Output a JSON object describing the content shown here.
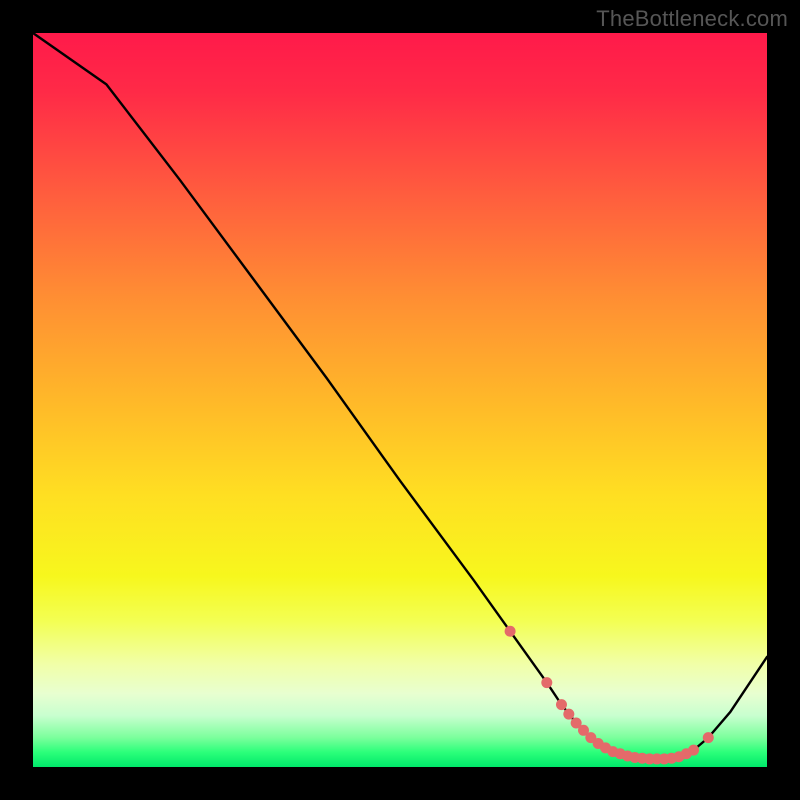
{
  "watermark": "TheBottleneck.com",
  "chart_data": {
    "type": "line",
    "title": "",
    "xlabel": "",
    "ylabel": "",
    "xlim": [
      0,
      100
    ],
    "ylim": [
      0,
      100
    ],
    "series": [
      {
        "name": "curve",
        "x": [
          0,
          10,
          20,
          30,
          40,
          50,
          60,
          65,
          70,
          72,
          74,
          76,
          78,
          80,
          82,
          84,
          86,
          88,
          90,
          92,
          95,
          100
        ],
        "y": [
          100,
          93,
          80,
          66.5,
          53,
          39,
          25.5,
          18.5,
          11.5,
          8.5,
          6,
          4,
          2.6,
          1.8,
          1.3,
          1.1,
          1.1,
          1.4,
          2.3,
          4.0,
          7.5,
          15
        ]
      }
    ],
    "markers": {
      "name": "highlight-dots",
      "x": [
        65,
        70,
        72,
        73,
        74,
        75,
        76,
        77,
        78,
        79,
        80,
        81,
        82,
        83,
        84,
        85,
        86,
        87,
        88,
        89,
        90,
        92
      ],
      "y": [
        18.5,
        11.5,
        8.5,
        7.2,
        6.0,
        5.0,
        4.0,
        3.2,
        2.6,
        2.1,
        1.8,
        1.5,
        1.3,
        1.2,
        1.1,
        1.1,
        1.1,
        1.2,
        1.4,
        1.8,
        2.3,
        4.0
      ]
    },
    "colors": {
      "curve": "#000000",
      "markers": "#e46a6a"
    }
  }
}
